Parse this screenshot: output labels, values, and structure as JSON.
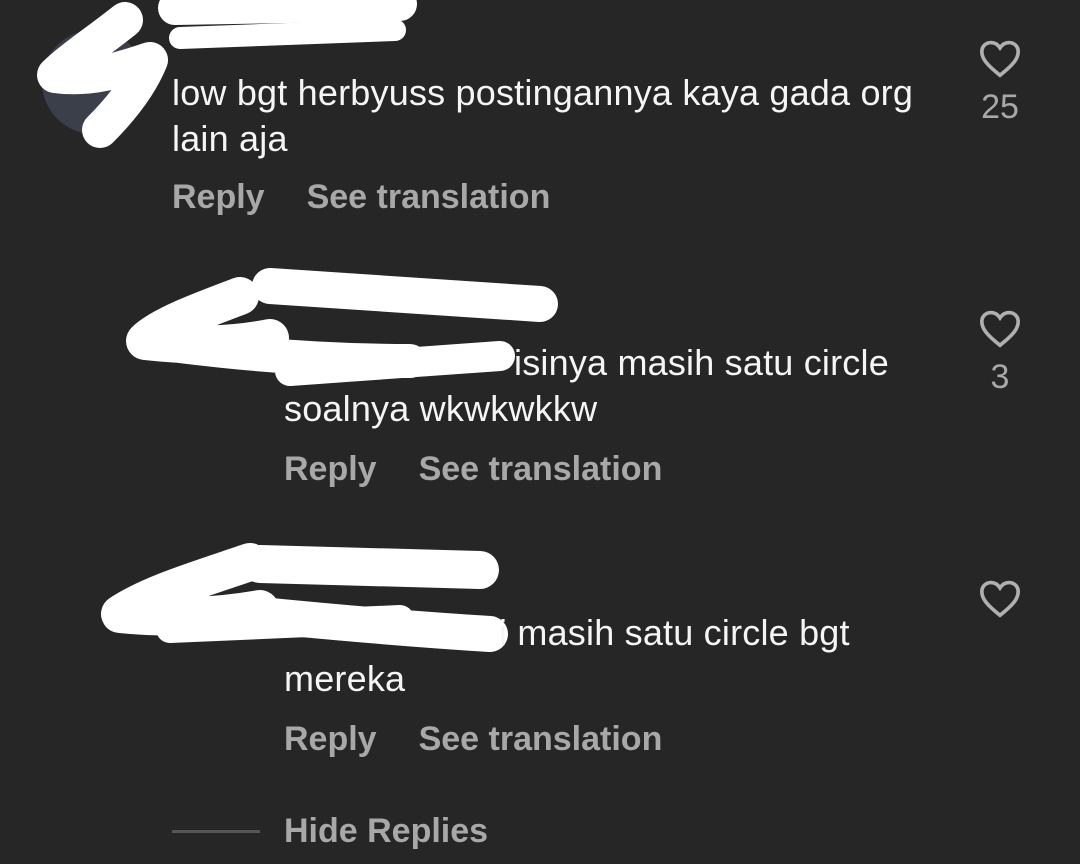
{
  "colors": {
    "background": "#262626",
    "text_primary": "#f5f5f5",
    "text_secondary": "#a8a8a8",
    "redaction": "#ffffff"
  },
  "comments": [
    {
      "text": "low bgt herbyuss postingannya kaya gada org lain aja",
      "reply_label": "Reply",
      "translate_label": "See translation",
      "likes": "25",
      "icon": "heart-outline-icon"
    },
    {
      "text": "isinya masih satu circle soalnya wkwkwkkw",
      "reply_label": "Reply",
      "translate_label": "See translation",
      "likes": "3",
      "icon": "heart-outline-icon"
    },
    {
      "text": "i masih satu circle bgt mereka",
      "reply_label": "Reply",
      "translate_label": "See translation",
      "likes": "",
      "icon": "heart-outline-icon"
    }
  ],
  "hide_replies_label": "Hide Replies"
}
